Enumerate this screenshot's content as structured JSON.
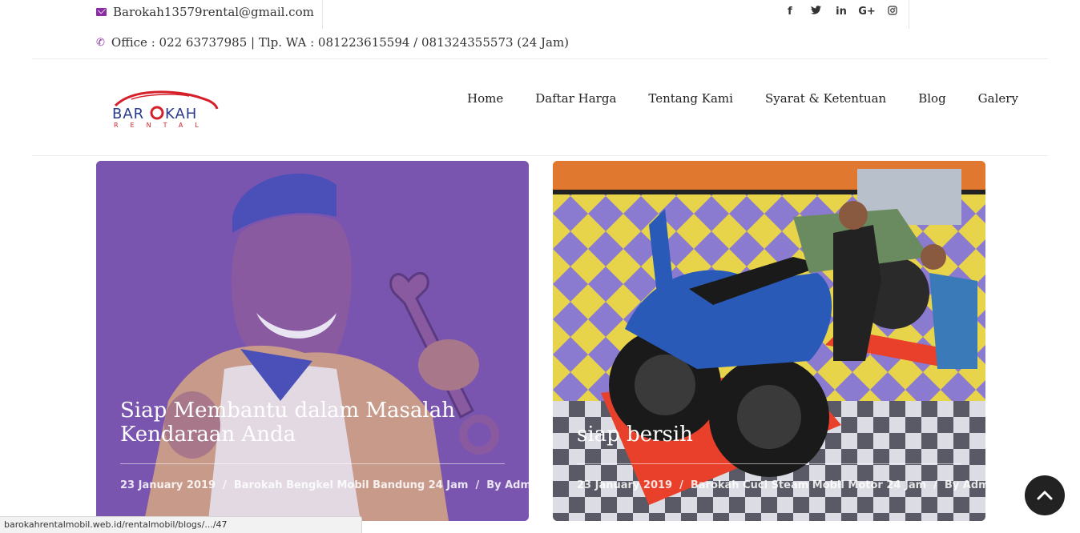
{
  "topbar": {
    "email": "Barokah13579rental@gmail.com",
    "phone": "Office : 022 63737985 | Tlp. WA : 081223615594 / 081324355573 (24 Jam)",
    "socials": [
      {
        "icon": "facebook-icon",
        "glyph": "f"
      },
      {
        "icon": "twitter-icon",
        "glyph": "t"
      },
      {
        "icon": "linkedin-icon",
        "glyph": "in"
      },
      {
        "icon": "google-plus-icon",
        "glyph": "G+"
      },
      {
        "icon": "instagram-icon",
        "glyph": "◎"
      }
    ]
  },
  "logo": {
    "text_top": "BAROKAH",
    "text_bottom": "RENTAL"
  },
  "nav": [
    {
      "label": "Home"
    },
    {
      "label": "Daftar Harga"
    },
    {
      "label": "Tentang Kami"
    },
    {
      "label": "Syarat & Ketentuan"
    },
    {
      "label": "Blog"
    },
    {
      "label": "Galery"
    }
  ],
  "cards": [
    {
      "title_line1": "Siap Membantu dalam Masalah",
      "title_line2": "Kendaraan Anda",
      "date": "23 January 2019",
      "category": "Barokah Bengkel Mobil Bandung 24 Jam",
      "author": "By Admin"
    },
    {
      "title_line1": "siap bersih",
      "date": "23 January 2019",
      "category": "Barokah Cuci Steam Mobil Motor 24 Jam",
      "author": "By Admin"
    }
  ],
  "statusbar": {
    "url": "barokahrentalmobil.web.id/rentalmobil/blogs/.../47"
  },
  "colors": {
    "accent": "#8a2ca3",
    "card_overlay": "#7a55b0",
    "logo_red": "#d5202a"
  }
}
